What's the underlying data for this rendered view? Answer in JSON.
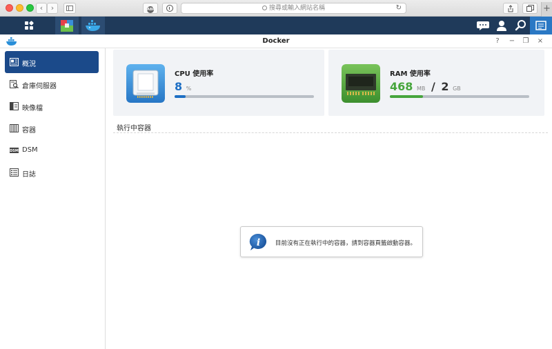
{
  "browser": {
    "url_placeholder": "搜尋或輸入網站名稱",
    "abp_label": "ABP",
    "plus_label": "+"
  },
  "window": {
    "title": "Docker",
    "help_glyph": "?",
    "minimize_glyph": "−",
    "restore_glyph": "❐",
    "close_glyph": "×"
  },
  "sidebar": {
    "items": [
      {
        "label": "概況",
        "active": true
      },
      {
        "label": "倉庫伺服器",
        "active": false
      },
      {
        "label": "映像檔",
        "active": false
      },
      {
        "label": "容器",
        "active": false
      },
      {
        "label": "DSM",
        "active": false
      },
      {
        "label": "日誌",
        "active": false
      }
    ]
  },
  "cpu": {
    "title": "CPU 使用率",
    "value": "8",
    "unit": "%",
    "usage_fraction": 0.08,
    "color": "#1e6fc4"
  },
  "ram": {
    "title": "RAM 使用率",
    "used": "468",
    "used_unit": "MB",
    "separator": "/",
    "total": "2",
    "total_unit": "GB",
    "usage_fraction": 0.24,
    "color": "#46a53c"
  },
  "running": {
    "section_title": "執行中容器",
    "empty_message": "目前沒有正在執行中的容器，請到容器頁籤啟動容器。"
  },
  "colors": {
    "taskbar": "#1f3a5a",
    "sidebar_active": "#1b4a8a",
    "accent_blue": "#2a78c4"
  }
}
